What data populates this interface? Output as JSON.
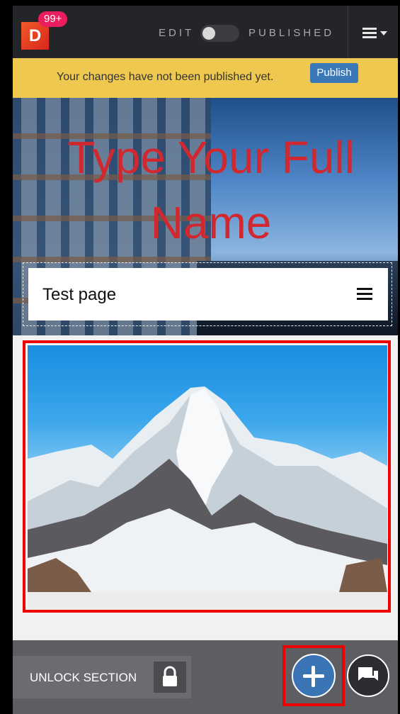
{
  "topbar": {
    "logo_letter": "D",
    "notification_count": "99+",
    "edit_label": "EDIT",
    "published_label": "PUBLISHED",
    "toggle_state": "edit"
  },
  "banner": {
    "message": "Your changes have not been published yet.",
    "publish_label": "Publish",
    "background": "#efc94f"
  },
  "hero": {
    "title": "Type Your Full Name",
    "title_color": "#d1282f",
    "nav_label": "Test page"
  },
  "bottom_bar": {
    "unlock_label": "UNLOCK SECTION"
  },
  "colors": {
    "highlight": "#f10000",
    "accent": "#3b74b4",
    "topbar": "#242528"
  }
}
